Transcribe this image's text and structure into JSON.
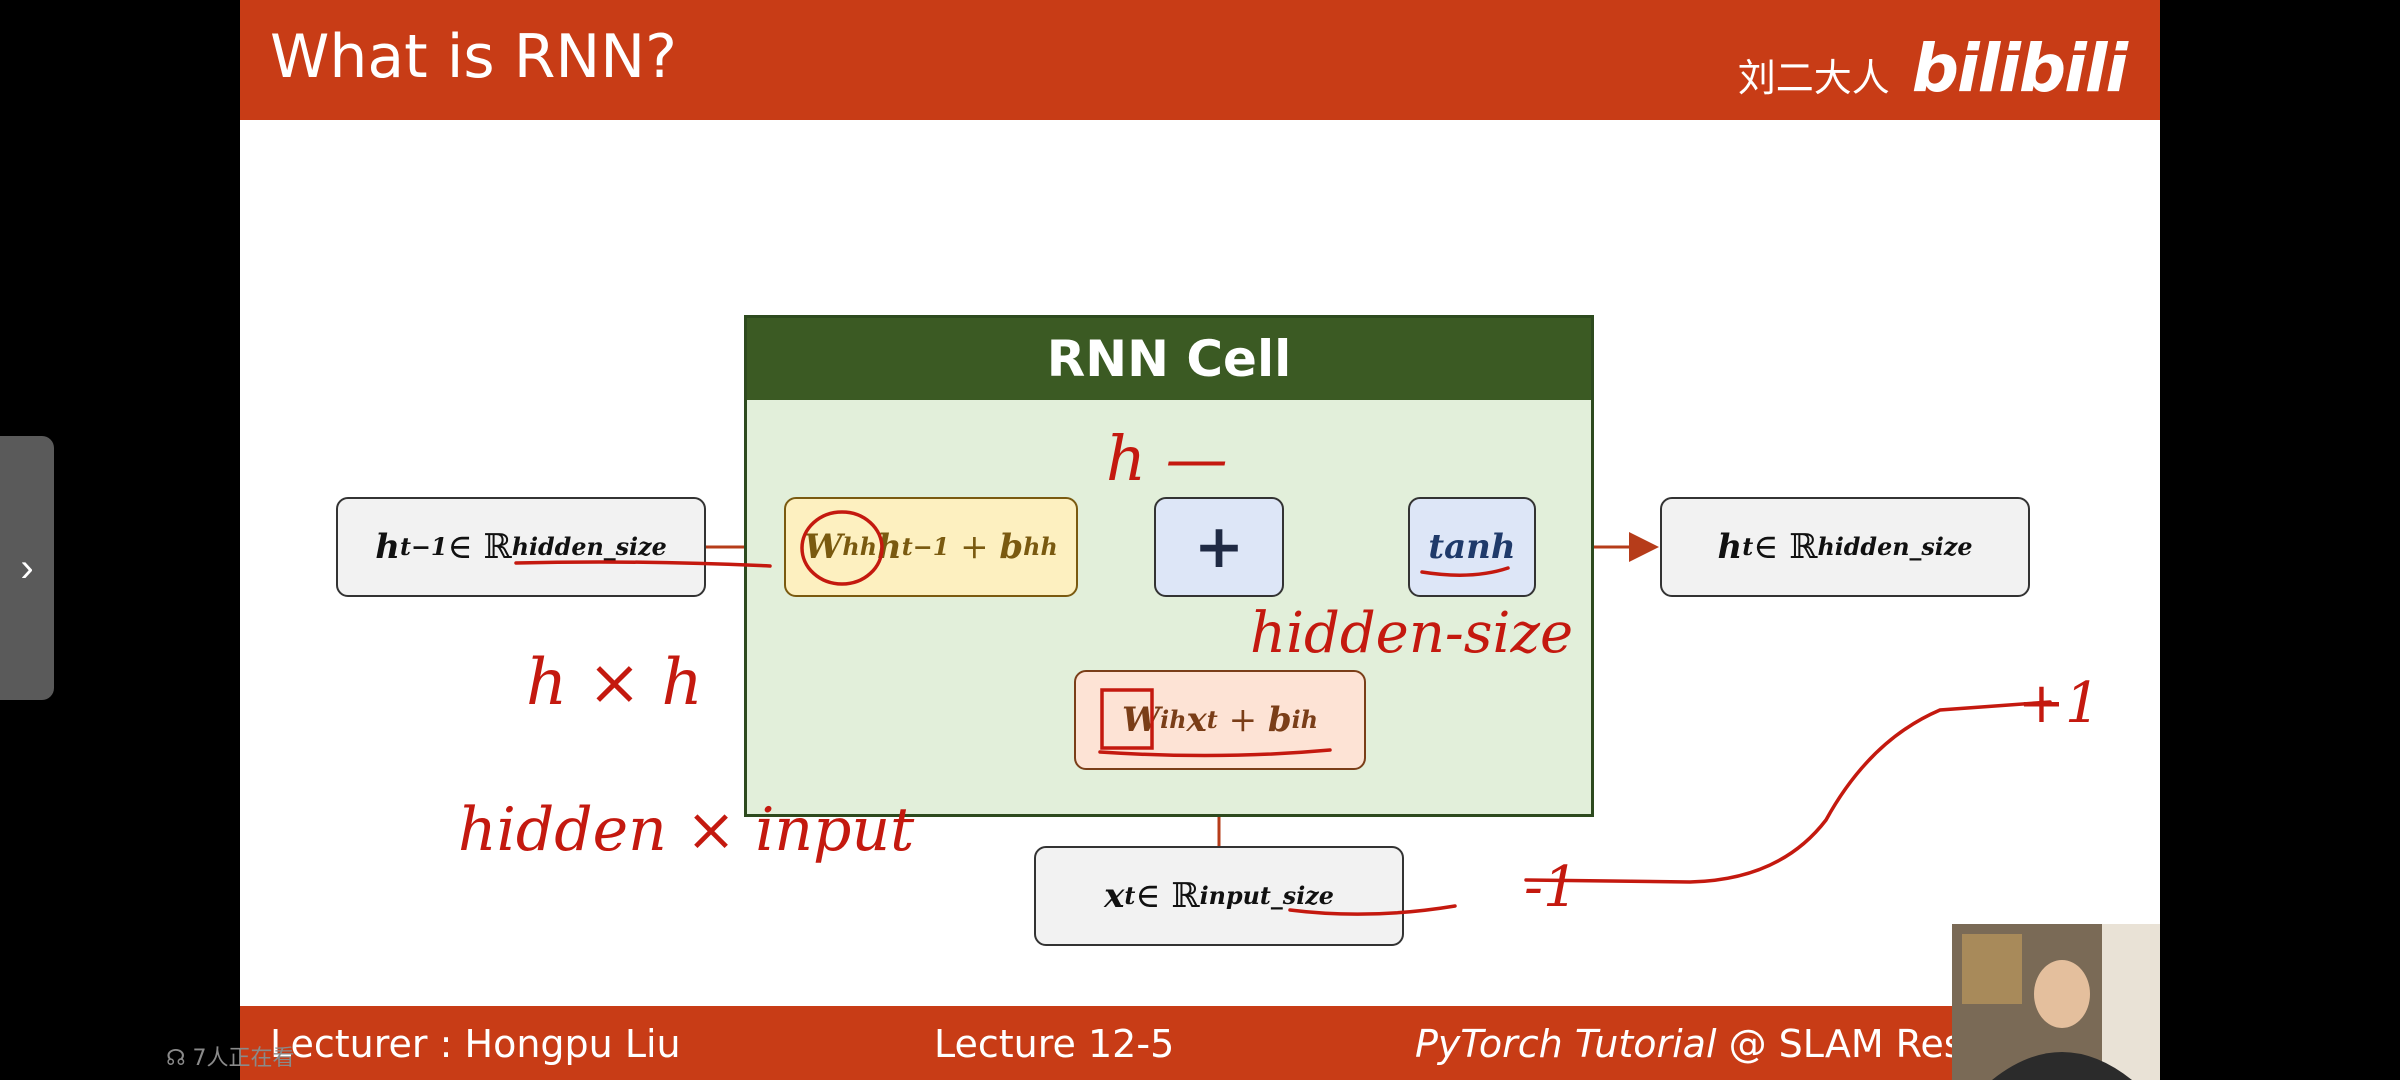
{
  "slide": {
    "title": "What is RNN?",
    "brand_author": "刘二大人",
    "brand_logo": "bilibili"
  },
  "footer": {
    "lecturer": "Lecturer : Hongpu Liu",
    "lecture": "Lecture 12-5",
    "tutorial": "PyTorch Tutorial",
    "org": " @ SLAM Resea"
  },
  "cell": {
    "title": "RNN Cell"
  },
  "boxes": {
    "h_prev": {
      "var": "h",
      "sub": "t−1",
      "set": " ∈ ℝ",
      "sup": "hidden_size"
    },
    "whh": {
      "w": "W",
      "w_sub": "hh",
      "h": "h",
      "h_sub": "t−1",
      "plus": " + ",
      "b": "b",
      "b_sub": "hh"
    },
    "plus": "+",
    "tanh": "tanh",
    "h_out": {
      "var": "h",
      "sub": "t",
      "set": " ∈ ℝ",
      "sup": "hidden_size"
    },
    "wih": {
      "w": "W",
      "w_sub": "ih",
      "x": "x",
      "x_sub": "t",
      "plus": " + ",
      "b": "b",
      "b_sub": "ih"
    },
    "x_in": {
      "var": "x",
      "sub": "t",
      "set": " ∈ ℝ",
      "sup": "input_size"
    }
  },
  "annotations": {
    "h_dash": "h —",
    "hidden_size": "hidden-size",
    "h_x_h": "h × h",
    "hidden_x_input": "hidden × input",
    "plus_one": "+1",
    "minus_one": "-1"
  },
  "overlay": {
    "viewers": "7人正在看",
    "side_arrow": "›"
  },
  "colors": {
    "accent": "#c83c16",
    "cell_header": "#3b5a23",
    "cell_fill": "#e2efda",
    "ink": "#c4190f"
  }
}
